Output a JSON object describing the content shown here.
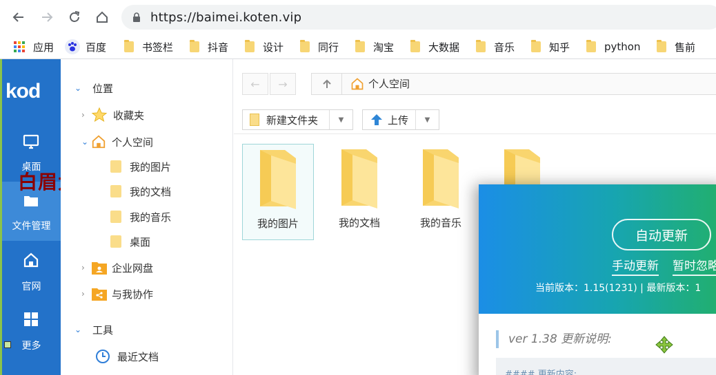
{
  "browser": {
    "url": "https://baimei.koten.vip"
  },
  "bookmarks": [
    {
      "label": "应用",
      "type": "apps"
    },
    {
      "label": "百度",
      "type": "baidu"
    },
    {
      "label": "书签栏",
      "type": "folder"
    },
    {
      "label": "抖音",
      "type": "folder"
    },
    {
      "label": "设计",
      "type": "folder"
    },
    {
      "label": "同行",
      "type": "folder"
    },
    {
      "label": "淘宝",
      "type": "folder"
    },
    {
      "label": "大数据",
      "type": "folder"
    },
    {
      "label": "音乐",
      "type": "folder"
    },
    {
      "label": "知乎",
      "type": "folder"
    },
    {
      "label": "python",
      "type": "folder"
    },
    {
      "label": "售前",
      "type": "folder"
    }
  ],
  "leftnav": {
    "logo": "kod",
    "items": [
      {
        "label": "桌面",
        "icon": "monitor-icon"
      },
      {
        "label": "文件管理",
        "icon": "folder-icon"
      },
      {
        "label": "官网",
        "icon": "home-icon"
      },
      {
        "label": "更多",
        "icon": "grid-icon"
      }
    ],
    "watermark": "白眉大叔"
  },
  "tree": {
    "section_location": "位置",
    "favorites": "收藏夹",
    "personal_space": "个人空间",
    "children": [
      "我的图片",
      "我的文档",
      "我的音乐",
      "桌面"
    ],
    "enterprise_disk": "企业网盘",
    "shared_with_me": "与我协作",
    "section_tools": "工具",
    "recent_docs": "最近文档"
  },
  "main": {
    "path_current": "个人空间",
    "new_folder_label": "新建文件夹",
    "upload_label": "上传",
    "files": [
      "我的图片",
      "我的文档",
      "我的音乐",
      ""
    ]
  },
  "update_modal": {
    "auto_update_label": "自动更新",
    "manual_update_label": "手动更新",
    "ignore_label": "暂时忽略",
    "version_text": "当前版本：1.15(1231) | 最新版本：1",
    "notes_title": "ver 1.38 更新说明:",
    "notes_line": "#### 更新内容:"
  },
  "colors": {
    "nav_blue": "#2372c9",
    "nav_active": "#3d8ad8",
    "folder_yellow": "#fadd8a",
    "modal_gradient_start": "#1b8ee6",
    "modal_gradient_end": "#22b06a"
  }
}
